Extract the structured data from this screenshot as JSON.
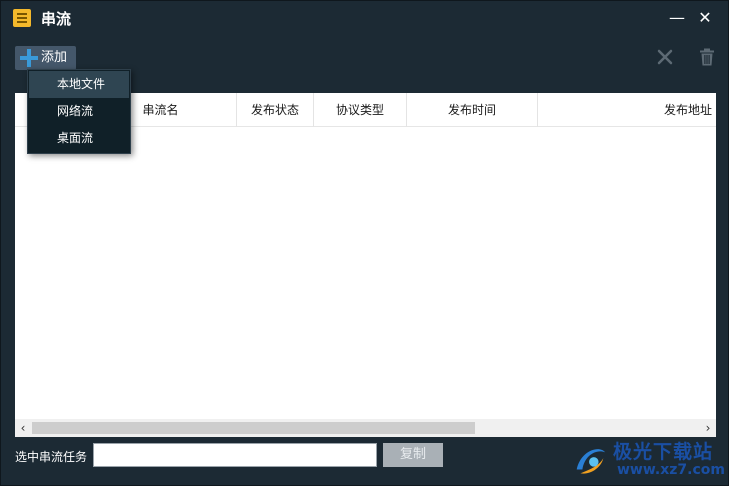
{
  "window": {
    "title": "串流",
    "minimize_label": "—",
    "close_label": "✕"
  },
  "toolbar": {
    "add_label": "添加"
  },
  "dropdown": {
    "items": [
      {
        "label": "本地文件"
      },
      {
        "label": "网络流"
      },
      {
        "label": "桌面流"
      }
    ]
  },
  "table": {
    "columns": [
      {
        "label": "串流名"
      },
      {
        "label": "发布状态"
      },
      {
        "label": "协议类型"
      },
      {
        "label": "发布时间"
      },
      {
        "label": "发布地址"
      }
    ]
  },
  "scrollbar": {
    "left_arrow": "‹",
    "right_arrow": "›"
  },
  "bottom": {
    "label": "选中串流任务",
    "input_value": "",
    "copy_label": "复制"
  },
  "watermark": {
    "text": "极光下载站",
    "url": "www.xz7.com"
  },
  "colors": {
    "chrome": "#1c2a34",
    "accent": "#3a9ad9",
    "app_icon": "#f4b92c"
  }
}
